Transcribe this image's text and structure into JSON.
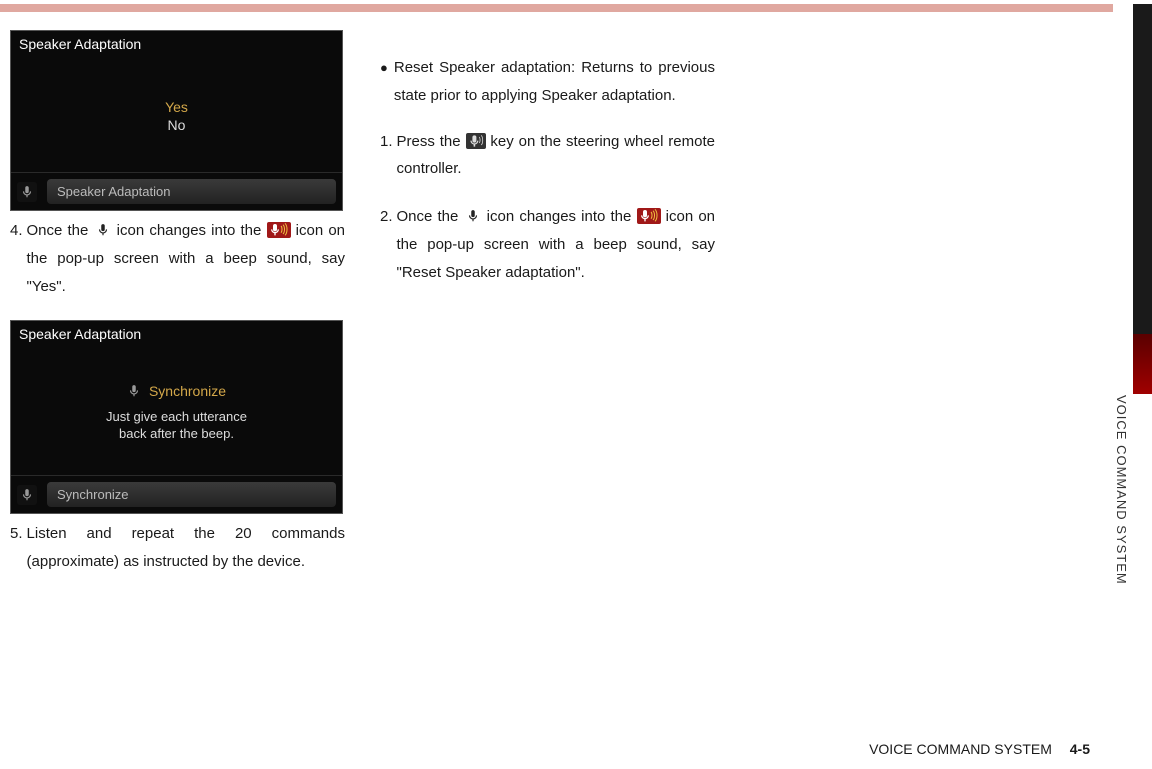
{
  "side_label": "VOICE COMMAND SYSTEM",
  "footer": {
    "label": "VOICE COMMAND SYSTEM",
    "page": "4-5"
  },
  "screenshot1": {
    "header": "Speaker Adaptation",
    "optionA": "Yes",
    "optionB": "No",
    "footer_text": "Speaker Adaptation"
  },
  "screenshot2": {
    "header": "Speaker Adaptation",
    "sync_label": "Synchronize",
    "hint_l1": "Just give each utterance",
    "hint_l2": "back after the beep.",
    "footer_text": "Synchronize"
  },
  "col1": {
    "step4_num": "4.",
    "step4_text_a": "Once the ",
    "step4_text_b": " icon changes into the ",
    "step4_text_c": "icon on the pop-up screen with a beep sound, say \"Yes\".",
    "step5_num": "5.",
    "step5_text": "Listen and repeat the 20 commands (approximate) as instructed by the device."
  },
  "col2": {
    "bullet_text": "Reset Speaker adaptation: Returns to previous state prior to applying Speaker adaptation.",
    "step1_num": "1.",
    "step1_text_a": "Press the ",
    "step1_text_b": " key on the steering wheel remote controller.",
    "step2_num": "2.",
    "step2_text_a": "Once the ",
    "step2_text_b": " icon changes into the ",
    "step2_text_c": " icon on the pop-up screen with a beep sound, say \"Reset Speaker adaptation\"."
  },
  "icons": {
    "mic_plain": "mic-plain-icon",
    "mic_waves": "mic-waves-icon",
    "voice_key": "voice-key-icon"
  }
}
